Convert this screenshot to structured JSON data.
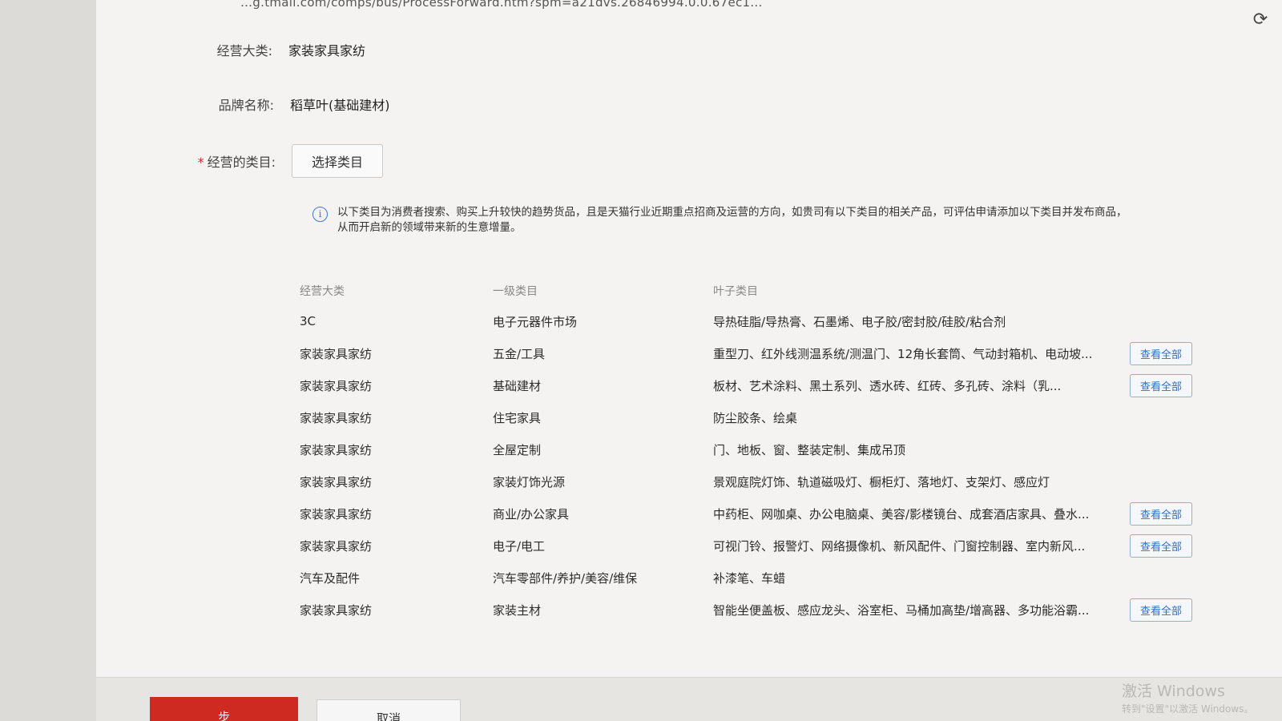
{
  "url": "…g.tmall.com/comps/bus/ProcessForward.htm?spm=a21dvs.26846994.0.0.67ec1...",
  "form": {
    "main_category_label": "经营大类:",
    "main_category_value": "家装家具家纺",
    "brand_label": "品牌名称:",
    "brand_value": "稻草叶(基础建材)",
    "required_star": "*",
    "categories_label": "经营的类目:",
    "select_button": "选择类目"
  },
  "notice": {
    "icon": "info-icon",
    "line1": "以下类目为消费者搜索、购买上升较快的趋势货品，且是天猫行业近期重点招商及运营的方向，如贵司有以下类目的相关产品，可评估申请添加以下类目并发布商品，",
    "line2": "从而开启新的领域带来新的生意增量。"
  },
  "table": {
    "headers": [
      "经营大类",
      "一级类目",
      "叶子类目"
    ],
    "rows": [
      {
        "main": "3C",
        "level1": "电子元器件市场",
        "leaf": "导热硅脂/导热膏、石墨烯、电子胶/密封胶/硅胶/粘合剂",
        "action": ""
      },
      {
        "main": "家装家具家纺",
        "level1": "五金/工具",
        "leaf": "重型刀、红外线测温系统/测温门、12角长套筒、气动封箱机、电动坡...",
        "action": "查看全部"
      },
      {
        "main": "家装家具家纺",
        "level1": "基础建材",
        "leaf": "板材、艺术涂料、黑土系列、透水砖、红砖、多孔砖、涂料（乳...",
        "action": "查看全部"
      },
      {
        "main": "家装家具家纺",
        "level1": "住宅家具",
        "leaf": "防尘胶条、绘桌",
        "action": ""
      },
      {
        "main": "家装家具家纺",
        "level1": "全屋定制",
        "leaf": "门、地板、窗、整装定制、集成吊顶",
        "action": ""
      },
      {
        "main": "家装家具家纺",
        "level1": "家装灯饰光源",
        "leaf": "景观庭院灯饰、轨道磁吸灯、橱柜灯、落地灯、支架灯、感应灯",
        "action": ""
      },
      {
        "main": "家装家具家纺",
        "level1": "商业/办公家具",
        "leaf": "中药柜、网咖桌、办公电脑桌、美容/影楼镜台、成套酒店家具、叠水...",
        "action": "查看全部"
      },
      {
        "main": "家装家具家纺",
        "level1": "电子/电工",
        "leaf": "可视门铃、报警灯、网络摄像机、新风配件、门窗控制器、室内新风...",
        "action": "查看全部"
      },
      {
        "main": "汽车及配件",
        "level1": "汽车零部件/养护/美容/维保",
        "leaf": "补漆笔、车蜡",
        "action": ""
      },
      {
        "main": "家装家具家纺",
        "level1": "家装主材",
        "leaf": "智能坐便盖板、感应龙头、浴室柜、马桶加高垫/增高器、多功能浴霸...",
        "action": "查看全部"
      }
    ]
  },
  "footer": {
    "next_label": "步",
    "cancel_label": "取消"
  },
  "watermark": {
    "line1": "激活 Windows",
    "line2": "转到\"设置\"以激活 Windows。"
  },
  "colors": {
    "accent_red": "#cf2a22",
    "link_blue": "#2f6fc2",
    "info_blue": "#3b78d8"
  }
}
